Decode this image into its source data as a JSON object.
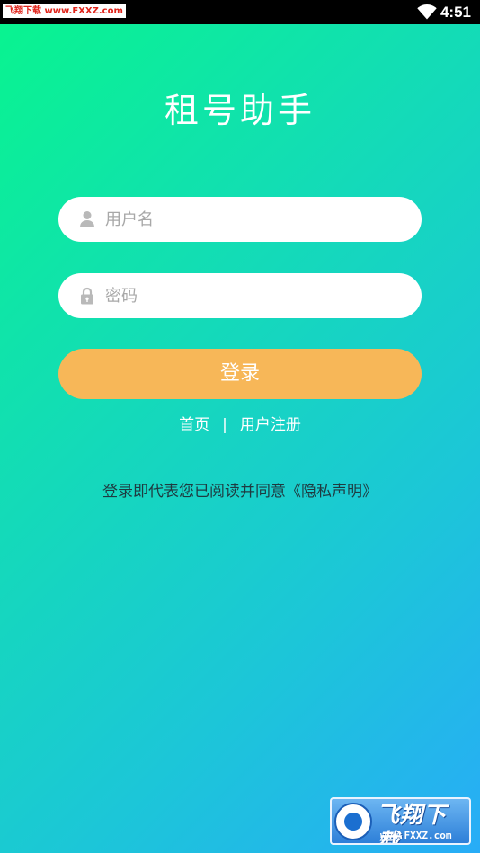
{
  "status_bar": {
    "watermark": "飞翔下载 www.FXXZ.com",
    "wifi_icon": "wifi-icon",
    "time": "4:51"
  },
  "app": {
    "title": "租号助手"
  },
  "form": {
    "username": {
      "icon": "user-icon",
      "placeholder": "用户名",
      "value": ""
    },
    "password": {
      "icon": "lock-icon",
      "placeholder": "密码",
      "value": ""
    },
    "login_label": "登录"
  },
  "links": {
    "home": "首页",
    "separator": "|",
    "register": "用户注册"
  },
  "agreement": {
    "text": "登录即代表您已阅读并同意",
    "privacy_link": "《隐私声明》"
  },
  "watermark_logo": {
    "brand": "飞翔下载",
    "domain": "www.FXXZ.com"
  },
  "colors": {
    "gradient_start": "#08F58E",
    "gradient_end": "#28ACF7",
    "login_button": "#F7B758",
    "input_background": "#FFFFFF",
    "placeholder": "#A8A8A8"
  }
}
